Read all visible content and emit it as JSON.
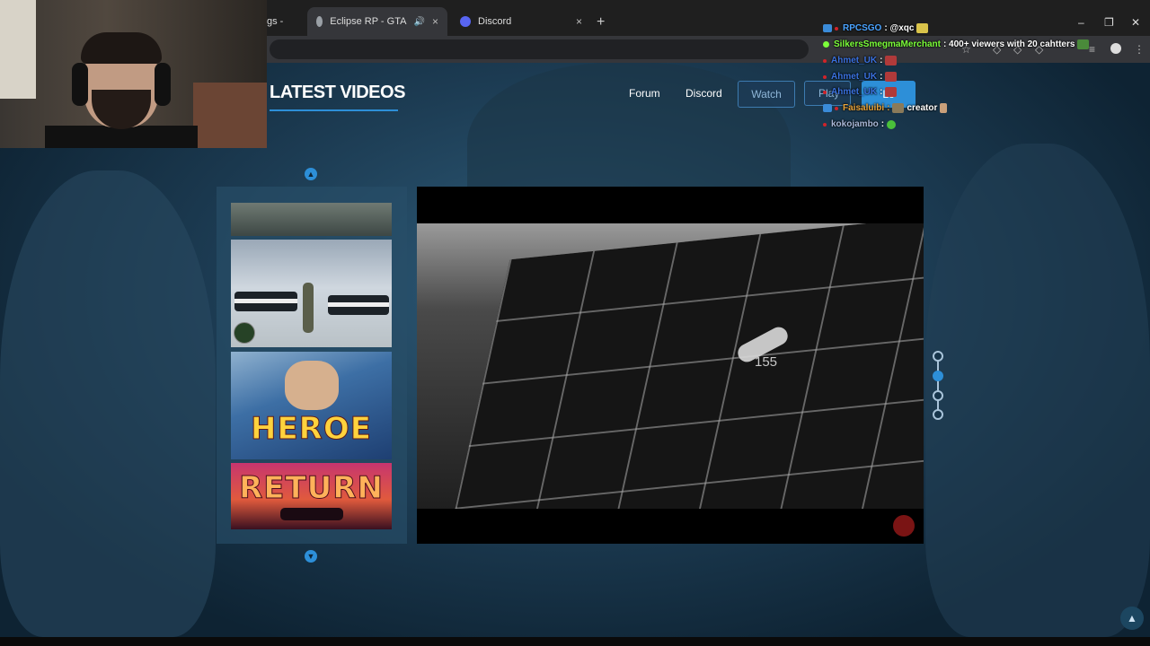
{
  "browser": {
    "tabs": [
      {
        "title": "gs - ",
        "active": false
      },
      {
        "title": "Eclipse RP - GTA V Roleplay",
        "active": true
      },
      {
        "title": "Discord",
        "active": false
      }
    ],
    "close_glyph": "×",
    "new_tab_glyph": "+",
    "window_controls": {
      "minimize": "–",
      "restore": "❐",
      "close": "✕"
    },
    "toolbar_icons": [
      "bookmark-star-icon",
      "extension-icon",
      "extension-icon",
      "extension-icon",
      "extension-icon",
      "profile-icon",
      "menu-icon"
    ]
  },
  "site": {
    "section_title": "LATEST VIDEOS",
    "nav": {
      "forum": "Forum",
      "discord": "Discord",
      "watch": "Watch",
      "play": "Play",
      "login": "Lo"
    },
    "accent_color": "#2d8fd8",
    "video_list": {
      "thumbnails": [
        {
          "caption": ""
        },
        {
          "caption": ""
        },
        {
          "caption": "HEROE"
        },
        {
          "caption": "RETURN"
        }
      ]
    },
    "player": {
      "overlay_number": "155"
    },
    "timeline_steps": 4,
    "timeline_active_index": 1
  },
  "chat": [
    {
      "user": "RPCSGO",
      "color": "#4aa3ff",
      "message": ": @xqc"
    },
    {
      "user": "SilkersSmegmaMerchant",
      "color": "#7cff3a",
      "message": ": 400+ viewers with 20 cahtters"
    },
    {
      "user": "Ahmet_UK",
      "color": "#3a72e0",
      "message": ":"
    },
    {
      "user": "Ahmet_UK",
      "color": "#3a72e0",
      "message": ":"
    },
    {
      "user": "Ahmet_UK",
      "color": "#3a72e0",
      "message": ":"
    },
    {
      "user": "Faisaluibi",
      "color": "#e8a33a",
      "message": "creator"
    },
    {
      "user": "kokojambo",
      "color": "#a9b8d8",
      "message": ":"
    }
  ]
}
